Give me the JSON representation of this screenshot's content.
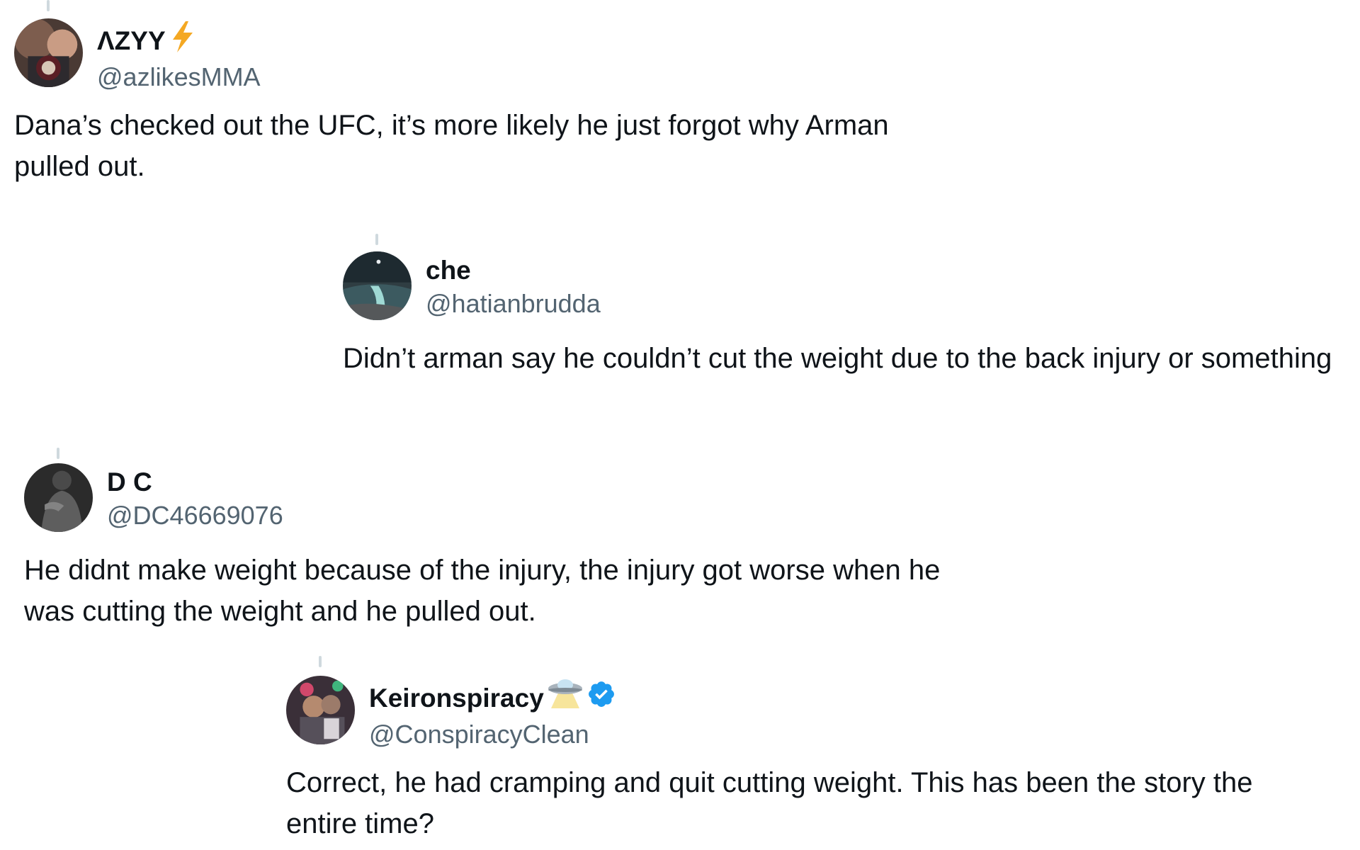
{
  "thread": [
    {
      "display_name": "ΛZYY",
      "display_emoji": "lightning-bolt-icon",
      "handle": "@azlikesMMA",
      "text": "Dana’s checked out the UFC, it’s more likely he just forgot why Arman pulled out.",
      "verified": false
    },
    {
      "display_name": "che",
      "handle": "@hatianbrudda",
      "text": "Didn’t arman say he couldn’t cut the weight due to the back injury or something",
      "verified": false
    },
    {
      "display_name": "D C",
      "handle": "@DC46669076",
      "text": "He didnt make weight because of the injury, the injury got worse when he was cutting the weight and he pulled out.",
      "verified": false
    },
    {
      "display_name": "Keironspiracy",
      "display_emoji": "ufo-icon",
      "handle": "@ConspiracyClean",
      "text": "Correct, he had cramping and quit cutting weight. This has been the story the entire time?",
      "verified": true
    }
  ],
  "colors": {
    "text": "#0f1419",
    "handle": "#536471",
    "verified": "#1d9bf0",
    "bolt": "#f4a823",
    "thread_line": "#cfd9de"
  }
}
